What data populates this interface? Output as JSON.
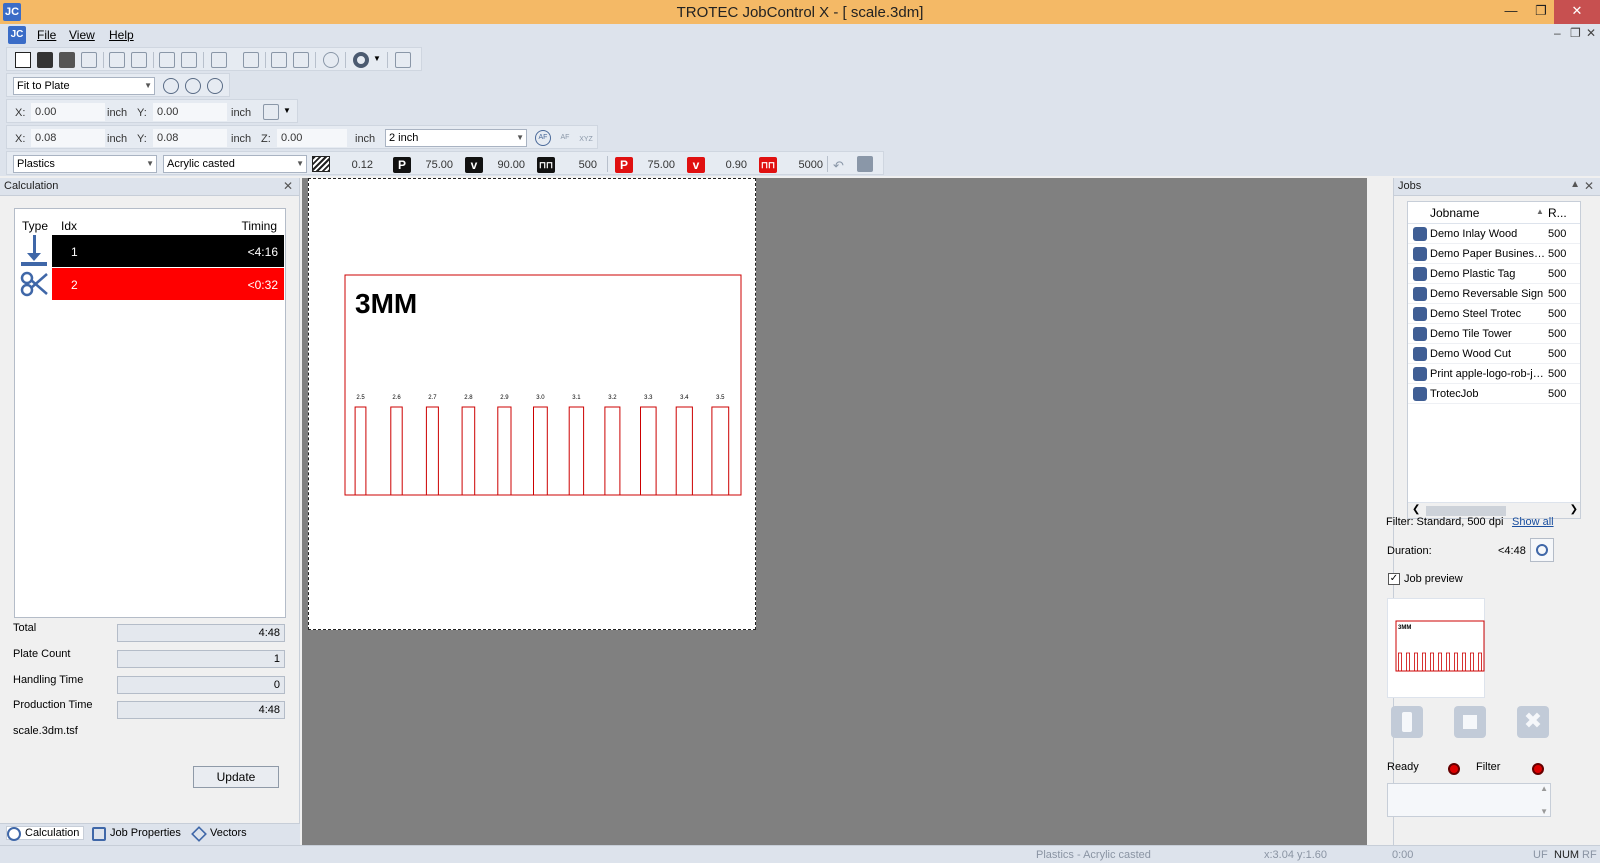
{
  "window": {
    "title": "TROTEC JobControl X - [ scale.3dm]",
    "logo": "JC"
  },
  "menu": {
    "items": [
      "File",
      "View",
      "Help"
    ]
  },
  "zoom": {
    "value": "Fit to Plate"
  },
  "pos1": {
    "x_label": "X:",
    "x": "0.00",
    "x_unit": "inch",
    "y_label": "Y:",
    "y": "0.00",
    "y_unit": "inch"
  },
  "pos2": {
    "x_label": "X:",
    "x": "0.08",
    "x_unit": "inch",
    "y_label": "Y:",
    "y": "0.08",
    "y_unit": "inch",
    "z_label": "Z:",
    "z": "0.00",
    "z_unit": "inch",
    "thickness": "2 inch",
    "af": "AF",
    "af2": "AF",
    "xyz": "XYZ"
  },
  "material": {
    "group": "Plastics",
    "type": "Acrylic casted",
    "thickness": "0.12",
    "engrave": {
      "p_label": "P",
      "p": "75.00",
      "v_label": "v",
      "v": "90.00",
      "freq": "500"
    },
    "cut": {
      "p_label": "P",
      "p": "75.00",
      "v_label": "v",
      "v": "0.90",
      "freq": "5000"
    }
  },
  "calc": {
    "title": "Calculation",
    "headers": {
      "type": "Type",
      "idx": "Idx",
      "timing": "Timing"
    },
    "rows": [
      {
        "idx": "1",
        "timing": "<4:16",
        "color": "#000000"
      },
      {
        "idx": "2",
        "timing": "<0:32",
        "color": "#ff0000"
      }
    ],
    "total_label": "Total",
    "total": "4:48",
    "plate_count_label": "Plate Count",
    "plate_count": "1",
    "handling_label": "Handling Time",
    "handling": "0",
    "production_label": "Production Time",
    "production": "4:48",
    "file": "scale.3dm.tsf",
    "update": "Update"
  },
  "bottom_tabs": {
    "calculation": "Calculation",
    "job_properties": "Job Properties",
    "vectors": "Vectors"
  },
  "design": {
    "title": "3MM",
    "ticks": [
      "2.5",
      "2.6",
      "2.7",
      "2.8",
      "2.9",
      "3.0",
      "3.1",
      "3.2",
      "3.3",
      "3.4",
      "3.5"
    ],
    "stroke": "#cc0000"
  },
  "jobs": {
    "title": "Jobs",
    "col_name": "Jobname",
    "col_r": "R...",
    "items": [
      {
        "name": "Demo Inlay Wood",
        "r": "500"
      },
      {
        "name": "Demo Paper Business...",
        "r": "500"
      },
      {
        "name": "Demo Plastic Tag",
        "r": "500"
      },
      {
        "name": "Demo Reversable Sign",
        "r": "500"
      },
      {
        "name": "Demo Steel Trotec",
        "r": "500"
      },
      {
        "name": "Demo Tile Tower",
        "r": "500"
      },
      {
        "name": "Demo Wood Cut",
        "r": "500"
      },
      {
        "name": "Print apple-logo-rob-ja...",
        "r": "500"
      },
      {
        "name": "TrotecJob",
        "r": "500"
      }
    ],
    "filter": "Filter: Standard, 500 dpi",
    "show_all": "Show all",
    "duration_label": "Duration:",
    "duration": "<4:48",
    "preview_label": "Job preview",
    "preview_text": "3MM",
    "ready": "Ready",
    "filter_label": "Filter"
  },
  "status": {
    "material": "Plastics - Acrylic casted",
    "coords": "x:3.04  y:1.60",
    "time": "0:00",
    "uf": "UF",
    "num": "NUM",
    "rf": "RF"
  }
}
